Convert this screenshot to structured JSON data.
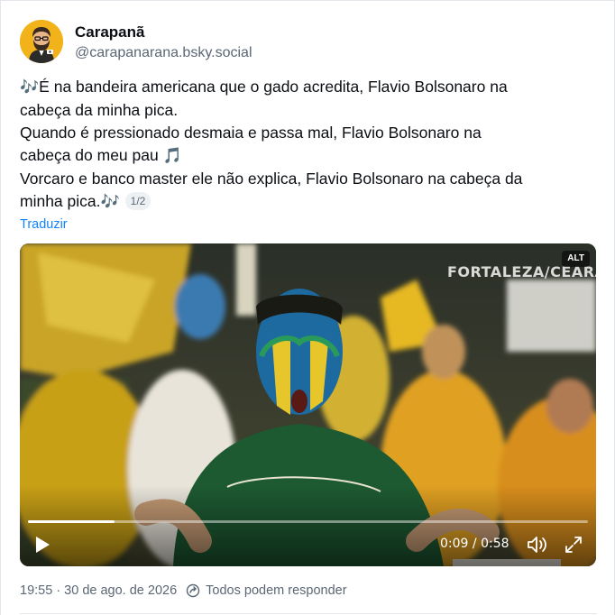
{
  "author": {
    "display_name": "Carapanã",
    "handle": "@carapanarana.bsky.social",
    "avatar_icon": "bearded-man-avatar"
  },
  "post": {
    "lines": [
      "É na bandeira americana que o gado acredita, Flavio Bolsonaro na",
      "cabeça da minha pica.",
      "Quando é pressionado desmaia e passa mal, Flavio Bolsonaro na",
      "cabeça do meu pau",
      "Vorcaro e banco master ele não explica, Flavio Bolsonaro na cabeça da",
      "minha pica."
    ],
    "notes_double": "🎶",
    "note_single": "🎵",
    "page_badge": "1/2",
    "translate_label": "Traduzir"
  },
  "video": {
    "watermark": "FORTALEZA/CEARÁ",
    "alt_badge": "ALT",
    "current_time": "0:09",
    "duration": "0:58",
    "progress_fraction": 0.155,
    "play_icon": "play-icon",
    "volume_icon": "volume-icon",
    "fullscreen_icon": "fullscreen-icon"
  },
  "meta": {
    "timestamp": "19:55 · 30 de ago. de 2026",
    "reply_setting": "Todos podem responder",
    "reply_icon": "reply-settings-icon"
  },
  "colors": {
    "link": "#1083fe",
    "muted": "#5b6775",
    "note": "#4ba3f2"
  }
}
